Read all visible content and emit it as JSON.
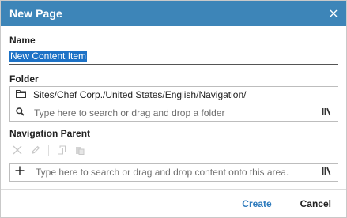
{
  "dialog": {
    "title": "New Page",
    "close_icon": "close-icon"
  },
  "name": {
    "label": "Name",
    "value": "New Content Item"
  },
  "folder": {
    "label": "Folder",
    "folder_icon": "folder-icon",
    "path": "Sites/Chef Corp./United States/English/Navigation/",
    "search_icon": "search-icon",
    "search_placeholder": "Type here to search or drag and drop a folder",
    "library_icon": "library-icon"
  },
  "navigation_parent": {
    "label": "Navigation Parent",
    "toolbar_icons": [
      "remove-icon",
      "edit-icon",
      "copy-icon",
      "paste-icon"
    ],
    "add_icon": "plus-icon",
    "search_placeholder": "Type here to search or drag and drop content onto this area.",
    "library_icon": "library-icon"
  },
  "footer": {
    "create_label": "Create",
    "cancel_label": "Cancel"
  },
  "colors": {
    "titlebar": "#3d85b8",
    "selection": "#1d72c6",
    "create": "#2e7bbd"
  }
}
